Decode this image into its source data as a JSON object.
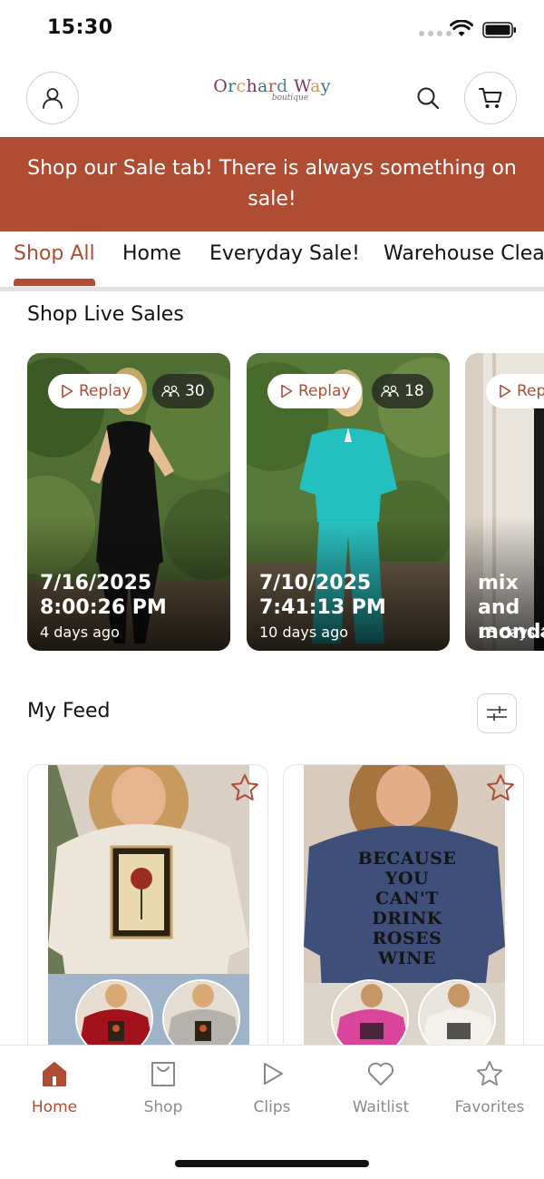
{
  "status_bar": {
    "time": "15:30"
  },
  "header": {
    "logo_main": "Orchard Way",
    "logo_sub": "boutique",
    "icons": {
      "account": "user-icon",
      "search": "search-icon",
      "cart": "cart-icon"
    }
  },
  "banner": {
    "text": "Shop our Sale tab! There is always something on sale!"
  },
  "tabs": [
    {
      "label": "Shop All",
      "active": true
    },
    {
      "label": "Home"
    },
    {
      "label": "Everyday Sale!"
    },
    {
      "label": "Warehouse Clea"
    }
  ],
  "live_sales": {
    "title": "Shop Live Sales",
    "replay_label": "Replay",
    "cards": [
      {
        "date": "7/16/2025 8:00:26 PM",
        "ago": "4 days ago",
        "viewers": "30"
      },
      {
        "date": "7/10/2025 7:41:13 PM",
        "ago": "10 days ago",
        "viewers": "18"
      },
      {
        "date": "mix and monda",
        "ago": "13 days a",
        "replay": "Rep"
      }
    ]
  },
  "feed": {
    "title": "My Feed",
    "cards": [
      {
        "shirt_text": ""
      },
      {
        "shirt_text": "BECAUSE YOU Can't DRINK ROSES wine"
      }
    ]
  },
  "bottom_nav": [
    {
      "label": "Home",
      "icon": "home-icon",
      "active": true
    },
    {
      "label": "Shop",
      "icon": "shopping-bag-icon"
    },
    {
      "label": "Clips",
      "icon": "play-icon"
    },
    {
      "label": "Waitlist",
      "icon": "heart-icon"
    },
    {
      "label": "Favorites",
      "icon": "star-icon"
    }
  ],
  "colors": {
    "accent": "#ae4c34",
    "muted": "#8a8a8a"
  }
}
